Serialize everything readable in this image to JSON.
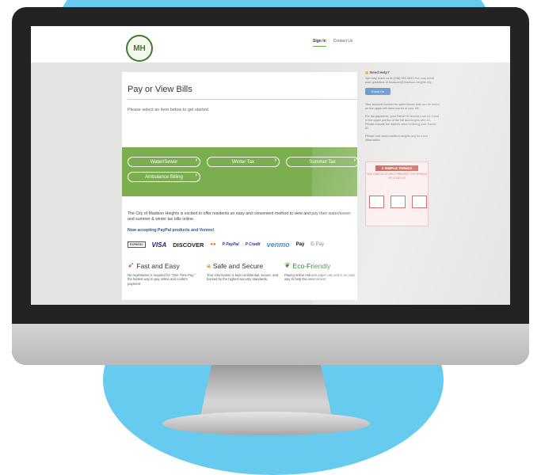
{
  "site": {
    "logo_text": "MH",
    "nav": [
      "Sign In",
      "Contact Us"
    ]
  },
  "page": {
    "title": "Pay or View Bills",
    "subtitle": "Please select an item below to get started.",
    "buttons": [
      "Water/Sewer",
      "Winter Tax",
      "Summer Tax",
      "Ambulance Billing"
    ],
    "intro": "The City of Madison Heights is excited to offer residents an easy and convenient method to view and pay their water/sewer and summer & winter tax bills online.",
    "paypal_note": "Now accepting PayPal products and Venmo!",
    "payment_methods": [
      "EXPRESS",
      "VISA",
      "DISCOVER",
      "●●",
      "P PayPal",
      "P Credit",
      "venmo",
      "Pay",
      "G Pay"
    ],
    "features": [
      {
        "title": "Fast and Easy",
        "desc": "No registration is required for \"One Time Pay,\" the fastest way to pay online and confirm payment."
      },
      {
        "title": "Safe and Secure",
        "desc": "Your information is kept confidential, secure, and backed by the highest security standards."
      },
      {
        "title": "Eco-Friendly",
        "desc": "Paying online reduces paper use and is an easy way to help the environment"
      }
    ]
  },
  "sidebar": {
    "help_title": "Need Help?",
    "help_text": "You may reach us at (248) 583-0840 You may email your questions to treasurer@madison-heights.org.",
    "email_button": "Email Us",
    "account_text": "Your account number for water/sewer bills can be found on the upper left-hand corner of your bill.",
    "tax_text": "For tax payments, your Parcel ID Number can be found in the upper portion of the bill and begins with 44. Please include the dashes when entering your Parcel ID.",
    "visit_text": "Please visit www.madison-heights.org for more information.",
    "covid_title": "3 SIMPLE THINGS",
    "covid_sub": "YOU CAN DO TO HELP PREVENT THE SPREAD OF COVID-19"
  }
}
